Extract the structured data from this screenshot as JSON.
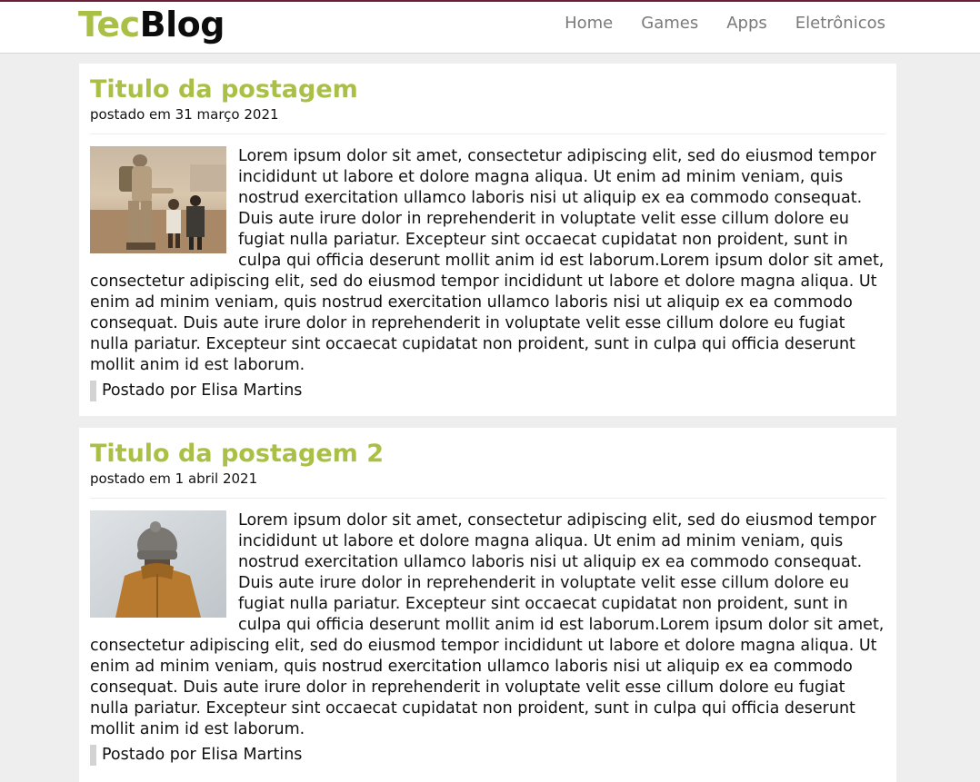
{
  "header": {
    "logo_part1": "Tec",
    "logo_part2": "Blog",
    "nav": [
      {
        "label": "Home"
      },
      {
        "label": "Games"
      },
      {
        "label": "Apps"
      },
      {
        "label": "Eletrônicos"
      }
    ]
  },
  "posts": [
    {
      "title": "Titulo da postagem",
      "date": "postado em 31 março 2021",
      "image": "soldier-with-children-photo",
      "body": "Lorem ipsum dolor sit amet, consectetur adipiscing elit, sed do eiusmod tempor incididunt ut labore et dolore magna aliqua. Ut enim ad minim veniam, quis nostrud exercitation ullamco laboris nisi ut aliquip ex ea commodo consequat. Duis aute irure dolor in reprehenderit in voluptate velit esse cillum dolore eu fugiat nulla pariatur. Excepteur sint occaecat cupidatat non proident, sunt in culpa qui officia deserunt mollit anim id est laborum.Lorem ipsum dolor sit amet, consectetur adipiscing elit, sed do eiusmod tempor incididunt ut labore et dolore magna aliqua. Ut enim ad minim veniam, quis nostrud exercitation ullamco laboris nisi ut aliquip ex ea commodo consequat. Duis aute irure dolor in reprehenderit in voluptate velit esse cillum dolore eu fugiat nulla pariatur. Excepteur sint occaecat cupidatat non proident, sunt in culpa qui officia deserunt mollit anim id est laborum.",
      "author": "Postado por Elisa Martins"
    },
    {
      "title": "Titulo da postagem 2",
      "date": "postado em 1 abril 2021",
      "image": "person-in-beanie-photo",
      "body": "Lorem ipsum dolor sit amet, consectetur adipiscing elit, sed do eiusmod tempor incididunt ut labore et dolore magna aliqua. Ut enim ad minim veniam, quis nostrud exercitation ullamco laboris nisi ut aliquip ex ea commodo consequat. Duis aute irure dolor in reprehenderit in voluptate velit esse cillum dolore eu fugiat nulla pariatur. Excepteur sint occaecat cupidatat non proident, sunt in culpa qui officia deserunt mollit anim id est laborum.Lorem ipsum dolor sit amet, consectetur adipiscing elit, sed do eiusmod tempor incididunt ut labore et dolore magna aliqua. Ut enim ad minim veniam, quis nostrud exercitation ullamco laboris nisi ut aliquip ex ea commodo consequat. Duis aute irure dolor in reprehenderit in voluptate velit esse cillum dolore eu fugiat nulla pariatur. Excepteur sint occaecat cupidatat non proident, sunt in culpa qui officia deserunt mollit anim id est laborum.",
      "author": "Postado por Elisa Martins"
    }
  ],
  "colors": {
    "brand_green": "#a9bf45",
    "top_border": "#6b1f3a",
    "nav_text": "#7a7a7a",
    "page_bg": "#eeeeee"
  }
}
